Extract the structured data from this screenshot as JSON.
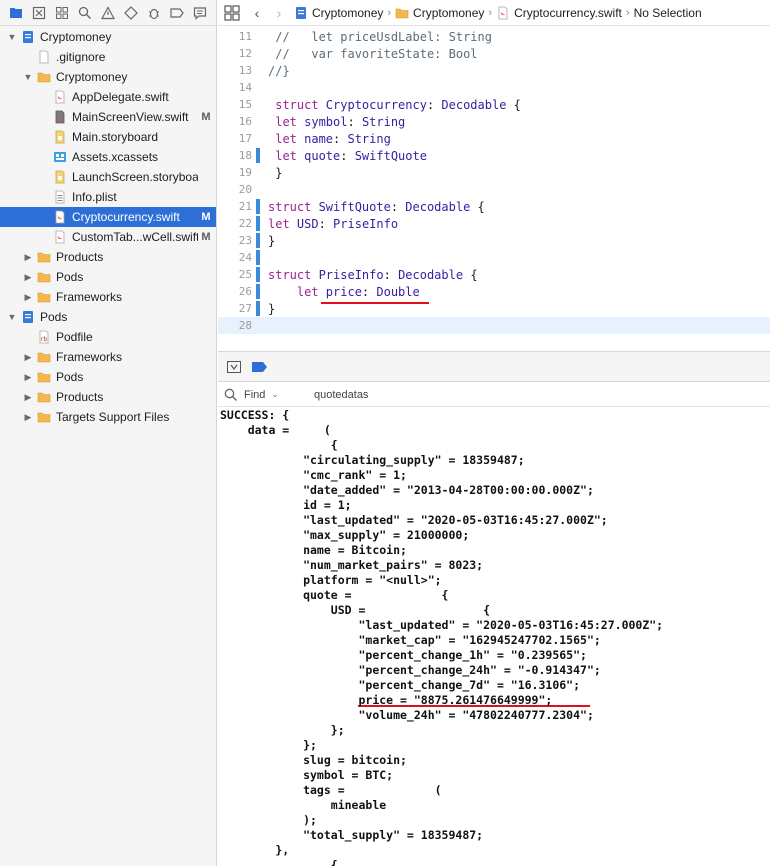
{
  "navigator": {
    "tools": [
      "folder-icon",
      "source-control-icon",
      "symbol-icon",
      "find-icon",
      "issue-warning-icon",
      "test-diamond-icon",
      "debug-icon",
      "breakpoint-icon",
      "report-icon"
    ],
    "items": [
      {
        "label": "Cryptomoney",
        "depth": 0,
        "disclosure": "open",
        "icon": "project",
        "badge": ""
      },
      {
        "label": ".gitignore",
        "depth": 1,
        "disclosure": "",
        "icon": "file",
        "badge": ""
      },
      {
        "label": "Cryptomoney",
        "depth": 1,
        "disclosure": "open",
        "icon": "folder",
        "badge": ""
      },
      {
        "label": "AppDelegate.swift",
        "depth": 2,
        "disclosure": "",
        "icon": "swift",
        "badge": ""
      },
      {
        "label": "MainScreenView.swift",
        "depth": 2,
        "disclosure": "",
        "icon": "swift-dark",
        "badge": "M"
      },
      {
        "label": "Main.storyboard",
        "depth": 2,
        "disclosure": "",
        "icon": "storyboard",
        "badge": ""
      },
      {
        "label": "Assets.xcassets",
        "depth": 2,
        "disclosure": "",
        "icon": "assets",
        "badge": ""
      },
      {
        "label": "LaunchScreen.storyboard",
        "depth": 2,
        "disclosure": "",
        "icon": "storyboard",
        "badge": ""
      },
      {
        "label": "Info.plist",
        "depth": 2,
        "disclosure": "",
        "icon": "plist",
        "badge": ""
      },
      {
        "label": "Cryptocurrency.swift",
        "depth": 2,
        "disclosure": "",
        "icon": "swift",
        "badge": "M",
        "selected": true
      },
      {
        "label": "CustomTab...wCell.swift",
        "depth": 2,
        "disclosure": "",
        "icon": "swift",
        "badge": "M"
      },
      {
        "label": "Products",
        "depth": 1,
        "disclosure": "closed",
        "icon": "folder",
        "badge": ""
      },
      {
        "label": "Pods",
        "depth": 1,
        "disclosure": "closed",
        "icon": "folder",
        "badge": ""
      },
      {
        "label": "Frameworks",
        "depth": 1,
        "disclosure": "closed",
        "icon": "folder",
        "badge": ""
      },
      {
        "label": "Pods",
        "depth": 0,
        "disclosure": "open",
        "icon": "project",
        "badge": ""
      },
      {
        "label": "Podfile",
        "depth": 1,
        "disclosure": "",
        "icon": "ruby",
        "badge": ""
      },
      {
        "label": "Frameworks",
        "depth": 1,
        "disclosure": "closed",
        "icon": "folder",
        "badge": ""
      },
      {
        "label": "Pods",
        "depth": 1,
        "disclosure": "closed",
        "icon": "folder",
        "badge": ""
      },
      {
        "label": "Products",
        "depth": 1,
        "disclosure": "closed",
        "icon": "folder",
        "badge": ""
      },
      {
        "label": "Targets Support Files",
        "depth": 1,
        "disclosure": "closed",
        "icon": "folder",
        "badge": ""
      }
    ],
    "ruby_icon_text": "rb"
  },
  "jumpbar": {
    "project": "Cryptomoney",
    "group": "Cryptomoney",
    "file": "Cryptocurrency.swift",
    "selection": "No Selection"
  },
  "editor": {
    "lines": [
      {
        "n": "11",
        "tokens": [
          {
            "t": " //   let priceUsdLabel: String",
            "c": "comment"
          }
        ]
      },
      {
        "n": "12",
        "tokens": [
          {
            "t": " //   var favoriteState: Bool",
            "c": "comment"
          }
        ]
      },
      {
        "n": "13",
        "tokens": [
          {
            "t": "//}",
            "c": "comment"
          }
        ]
      },
      {
        "n": "14",
        "tokens": []
      },
      {
        "n": "15",
        "tokens": [
          {
            "t": " struct ",
            "c": "kw"
          },
          {
            "t": "Cryptocurrency",
            "c": "type"
          },
          {
            "t": ": ",
            "c": "plain"
          },
          {
            "t": "Decodable",
            "c": "type"
          },
          {
            "t": " {",
            "c": "plain"
          }
        ]
      },
      {
        "n": "16",
        "tokens": [
          {
            "t": " let ",
            "c": "kw"
          },
          {
            "t": "symbol",
            "c": "type"
          },
          {
            "t": ": ",
            "c": "plain"
          },
          {
            "t": "String",
            "c": "type"
          }
        ]
      },
      {
        "n": "17",
        "tokens": [
          {
            "t": " let ",
            "c": "kw"
          },
          {
            "t": "name",
            "c": "type"
          },
          {
            "t": ": ",
            "c": "plain"
          },
          {
            "t": "String",
            "c": "type"
          }
        ]
      },
      {
        "n": "18",
        "tokens": [
          {
            "t": " let ",
            "c": "kw"
          },
          {
            "t": "quote",
            "c": "type"
          },
          {
            "t": ": ",
            "c": "plain"
          },
          {
            "t": "SwiftQuote",
            "c": "type"
          }
        ],
        "changed": true
      },
      {
        "n": "19",
        "tokens": [
          {
            "t": " }",
            "c": "plain"
          }
        ]
      },
      {
        "n": "20",
        "tokens": []
      },
      {
        "n": "21",
        "tokens": [
          {
            "t": "struct ",
            "c": "kw"
          },
          {
            "t": "SwiftQuote",
            "c": "type"
          },
          {
            "t": ": ",
            "c": "plain"
          },
          {
            "t": "Decodable",
            "c": "type"
          },
          {
            "t": " {",
            "c": "plain"
          }
        ],
        "changed": true
      },
      {
        "n": "22",
        "tokens": [
          {
            "t": "let ",
            "c": "kw"
          },
          {
            "t": "USD",
            "c": "type"
          },
          {
            "t": ": ",
            "c": "plain"
          },
          {
            "t": "PriseInfo",
            "c": "type"
          }
        ],
        "changed": true
      },
      {
        "n": "23",
        "tokens": [
          {
            "t": "}",
            "c": "plain"
          }
        ],
        "changed": true
      },
      {
        "n": "24",
        "tokens": [],
        "changed": true
      },
      {
        "n": "25",
        "tokens": [
          {
            "t": "struct ",
            "c": "kw"
          },
          {
            "t": "PriseInfo",
            "c": "type"
          },
          {
            "t": ": ",
            "c": "plain"
          },
          {
            "t": "Decodable",
            "c": "type"
          },
          {
            "t": " {",
            "c": "plain"
          }
        ],
        "changed": true
      },
      {
        "n": "26",
        "tokens": [
          {
            "t": "    let ",
            "c": "kw"
          },
          {
            "t": "price",
            "c": "type"
          },
          {
            "t": ": ",
            "c": "plain"
          },
          {
            "t": "Double",
            "c": "type"
          }
        ],
        "changed": true
      },
      {
        "n": "27",
        "tokens": [
          {
            "t": "}",
            "c": "plain"
          }
        ],
        "changed": true
      },
      {
        "n": "28",
        "tokens": [],
        "current": true
      }
    ]
  },
  "debug": {
    "filter_scope": "Find",
    "filter_value": "quotedatas"
  },
  "console": {
    "lines": [
      "SUCCESS: {",
      "    data =     (",
      "                {",
      "            \"circulating_supply\" = 18359487;",
      "            \"cmc_rank\" = 1;",
      "            \"date_added\" = \"2013-04-28T00:00:00.000Z\";",
      "            id = 1;",
      "            \"last_updated\" = \"2020-05-03T16:45:27.000Z\";",
      "            \"max_supply\" = 21000000;",
      "            name = Bitcoin;",
      "            \"num_market_pairs\" = 8023;",
      "            platform = \"<null>\";",
      "            quote =             {",
      "                USD =                 {",
      "                    \"last_updated\" = \"2020-05-03T16:45:27.000Z\";",
      "                    \"market_cap\" = \"162945247702.1565\";",
      "                    \"percent_change_1h\" = \"0.239565\";",
      "                    \"percent_change_24h\" = \"-0.914347\";",
      "                    \"percent_change_7d\" = \"16.3106\";",
      "                    price = \"8875.261476649999\";",
      "                    \"volume_24h\" = \"47802240777.2304\";",
      "                };",
      "            };",
      "            slug = bitcoin;",
      "            symbol = BTC;",
      "            tags =             (",
      "                mineable",
      "            );",
      "            \"total_supply\" = 18359487;",
      "        },",
      "                {"
    ]
  },
  "colors": {
    "keyword": "#9b2393",
    "type": "#3a1d9e",
    "comment": "#5d6c79",
    "selection": "#2d6fd7",
    "change_bar": "#3b8bdd",
    "annotation_underline": "#e0101a"
  }
}
